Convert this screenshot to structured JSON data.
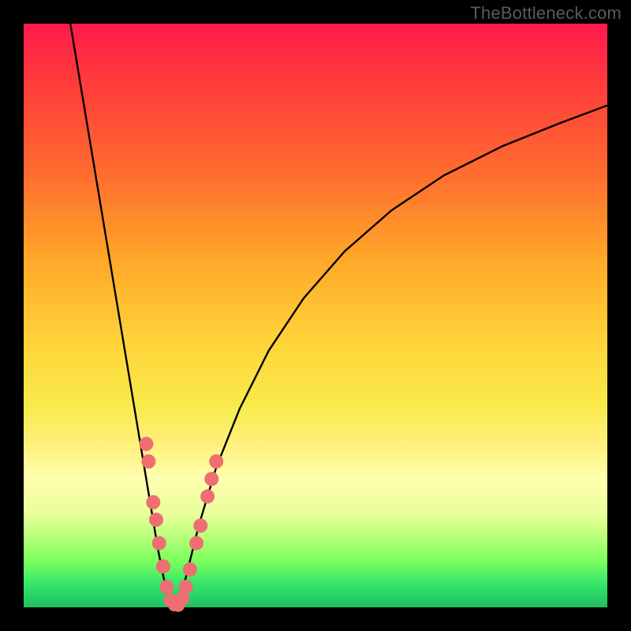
{
  "watermark": "TheBottleneck.com",
  "chart_data": {
    "type": "line",
    "title": "",
    "xlabel": "",
    "ylabel": "",
    "xlim": [
      0,
      100
    ],
    "ylim": [
      0,
      100
    ],
    "left_curve": {
      "x": [
        8,
        10,
        12,
        14,
        16,
        18,
        20,
        22,
        23,
        24,
        25,
        26
      ],
      "y": [
        100,
        88,
        76,
        64,
        52,
        40,
        28,
        16,
        10,
        5,
        1,
        0
      ]
    },
    "right_curve": {
      "x": [
        26,
        27,
        28,
        30,
        33,
        37,
        42,
        48,
        55,
        63,
        72,
        82,
        92,
        100
      ],
      "y": [
        0,
        2,
        6,
        14,
        24,
        34,
        44,
        53,
        61,
        68,
        74,
        79,
        83,
        86
      ]
    },
    "dots_left": [
      {
        "x": 21.0,
        "y": 28
      },
      {
        "x": 21.4,
        "y": 25
      },
      {
        "x": 22.2,
        "y": 18
      },
      {
        "x": 22.7,
        "y": 15
      },
      {
        "x": 23.2,
        "y": 11
      },
      {
        "x": 23.9,
        "y": 7
      },
      {
        "x": 24.5,
        "y": 3.5
      },
      {
        "x": 25.2,
        "y": 1.2
      }
    ],
    "dots_right": [
      {
        "x": 27.2,
        "y": 1.5
      },
      {
        "x": 27.8,
        "y": 3.5
      },
      {
        "x": 28.5,
        "y": 6.5
      },
      {
        "x": 29.6,
        "y": 11
      },
      {
        "x": 30.3,
        "y": 14
      },
      {
        "x": 31.5,
        "y": 19
      },
      {
        "x": 32.2,
        "y": 22
      },
      {
        "x": 33.0,
        "y": 25
      }
    ],
    "dots_bottom": [
      {
        "x": 25.8,
        "y": 0.4
      },
      {
        "x": 26.5,
        "y": 0.3
      }
    ],
    "dot_color": "#ee6e71",
    "curve_color": "#000000"
  }
}
